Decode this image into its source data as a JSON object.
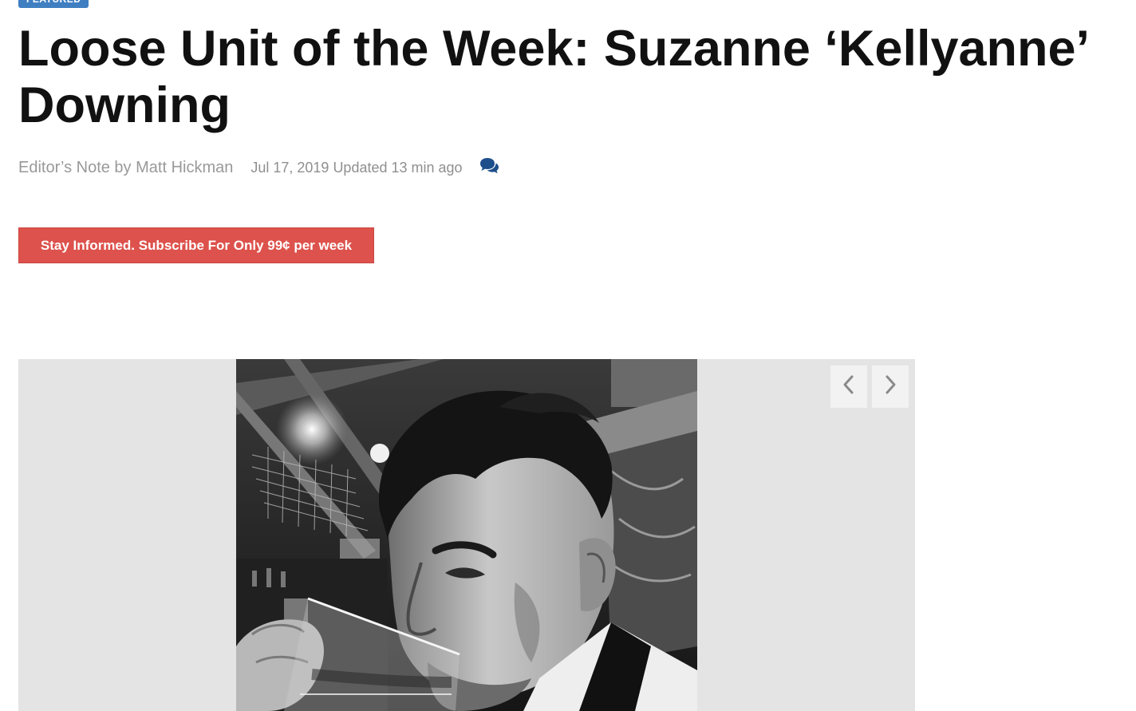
{
  "article": {
    "section_badge": "FEATURED",
    "headline": "Loose Unit of the Week: Suzanne ‘Kellyanne’ Downing",
    "byline": "Editor’s Note by Matt Hickman",
    "date": "Jul 17, 2019 Updated 13 min ago",
    "comments_icon": "comments-icon"
  },
  "subscribe": {
    "label": "Stay Informed. Subscribe For Only 99¢ per week"
  },
  "gallery": {
    "photo_alt": "Black and white photo of a man drinking from a glass in a bar",
    "prev_icon": "chevron-left-icon",
    "next_icon": "chevron-right-icon"
  },
  "colors": {
    "badge": "#3f7fc1",
    "subscribe_bg": "#dd524c",
    "comments_icon": "#1d4f8a",
    "byline_text": "#999999"
  }
}
